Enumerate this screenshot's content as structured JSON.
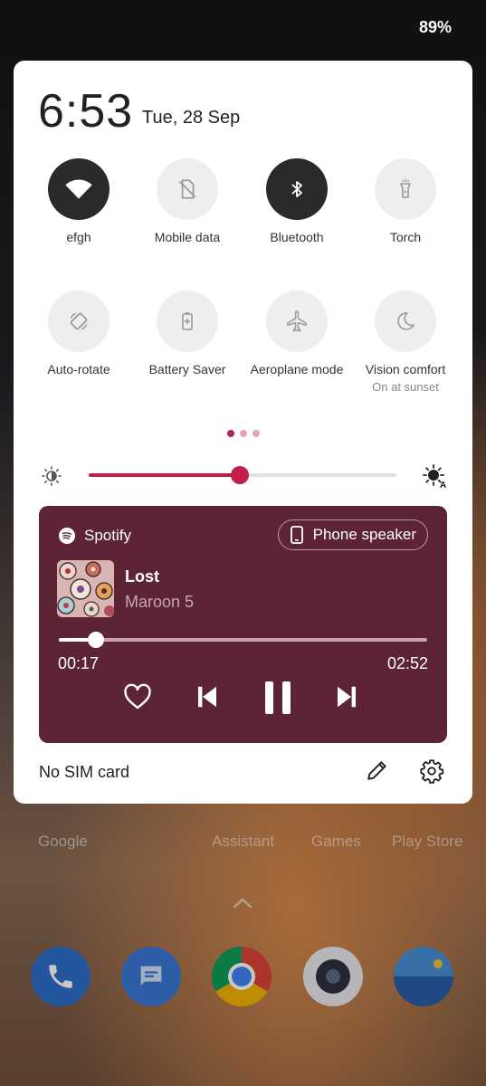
{
  "status_bar": {
    "battery": "89%"
  },
  "header": {
    "time": "6:53",
    "date": "Tue, 28 Sep"
  },
  "tiles": [
    {
      "label": "efgh",
      "icon": "wifi-icon",
      "on": true
    },
    {
      "label": "Mobile data",
      "icon": "mobile-data-off-icon",
      "on": false
    },
    {
      "label": "Bluetooth",
      "icon": "bluetooth-icon",
      "on": true
    },
    {
      "label": "Torch",
      "icon": "torch-icon",
      "on": false
    },
    {
      "label": "Auto-rotate",
      "icon": "auto-rotate-icon",
      "on": false
    },
    {
      "label": "Battery Saver",
      "icon": "battery-saver-icon",
      "on": false
    },
    {
      "label": "Aeroplane mode",
      "icon": "airplane-icon",
      "on": false
    },
    {
      "label": "Vision comfort",
      "sublabel": "On at sunset",
      "icon": "moon-icon",
      "on": false
    }
  ],
  "page_indicator": {
    "count": 3,
    "active": 0
  },
  "brightness": {
    "level": 0.49
  },
  "media": {
    "app": "Spotify",
    "output": "Phone speaker",
    "title": "Lost",
    "artist": "Maroon 5",
    "elapsed": "00:17",
    "duration": "02:52",
    "progress": 0.1,
    "background": "#5c2435"
  },
  "footer": {
    "sim_status": "No SIM card"
  },
  "home": {
    "labels": [
      "Google",
      "Assistant",
      "Games",
      "Play Store"
    ],
    "dock": [
      "phone-icon",
      "messages-icon",
      "chrome-icon",
      "camera-icon",
      "gallery-icon"
    ]
  },
  "colors": {
    "accent": "#c21e4c",
    "tile_on": "#2a2a2a",
    "tile_off": "#eeeeee"
  }
}
